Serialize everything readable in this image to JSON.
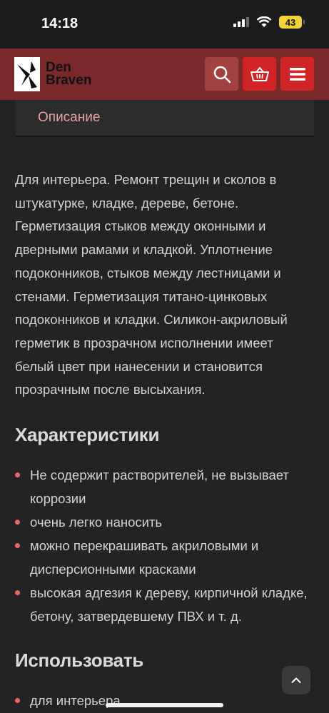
{
  "status_bar": {
    "time": "14:18",
    "battery": "43"
  },
  "header": {
    "logo_line1": "Den",
    "logo_line2": "Braven",
    "icons": {
      "search": "search-icon",
      "cart": "basket-icon",
      "menu": "hamburger-icon"
    },
    "colors": {
      "bar": "#7a2a2b",
      "button": "#d12427",
      "search_button": "#a14142"
    }
  },
  "tab": {
    "label": "Описание"
  },
  "description": "Для интерьера. Ремонт трещин и сколов в штукатурке, кладке, дереве, бетоне. Герметизация стыков между оконными и дверными рамами и кладкой. Уплотнение подоконников, стыков между лестницами и стенами. Герметизация титано-цинковых подоконников и кладки. Силикон-акриловый герметик в прозрачном исполнении имеет белый цвет при нанесении и становится прозрачным после высыхания.",
  "characteristics": {
    "title": "Характеристики",
    "items": [
      "Не содержит растворителей, не вызывает коррозии",
      "очень легко наносить",
      "можно перекрашивать акриловыми и дисперсионными красками",
      "высокая адгезия к дереву, кирпичной кладке, бетону, затвердевшему ПВХ и т. д."
    ]
  },
  "usage": {
    "title": "Использовать",
    "items": [
      "для интерьера"
    ]
  },
  "bullet_color": "#e46a6a"
}
